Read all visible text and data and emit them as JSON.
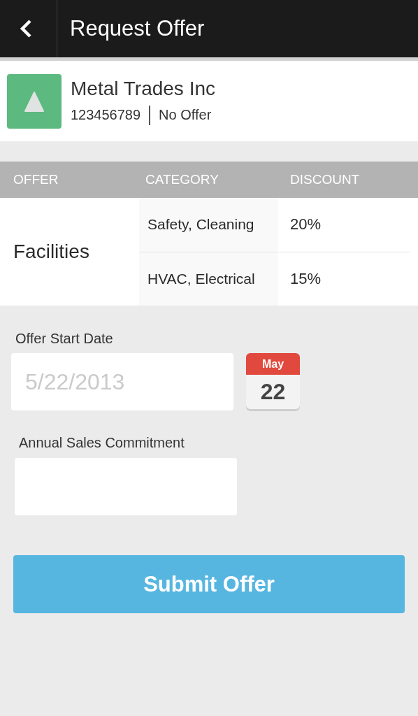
{
  "header": {
    "title": "Request Offer"
  },
  "company": {
    "name": "Metal Trades Inc",
    "number": "123456789",
    "status": "No Offer"
  },
  "table": {
    "columns": [
      "OFFER",
      "CATEGORY",
      "DISCOUNT"
    ],
    "rows": [
      {
        "offer": "Facilities",
        "items": [
          {
            "category": "Safety, Cleaning",
            "discount": "20%"
          },
          {
            "category": "HVAC, Electrical",
            "discount": "15%"
          }
        ]
      }
    ]
  },
  "start_date": {
    "label": "Offer Start Date",
    "placeholder": "5/22/2013",
    "calendar": {
      "month": "May",
      "day": "22"
    }
  },
  "commitment": {
    "label": "Annual Sales Commitment"
  },
  "submit": "Submit Offer"
}
